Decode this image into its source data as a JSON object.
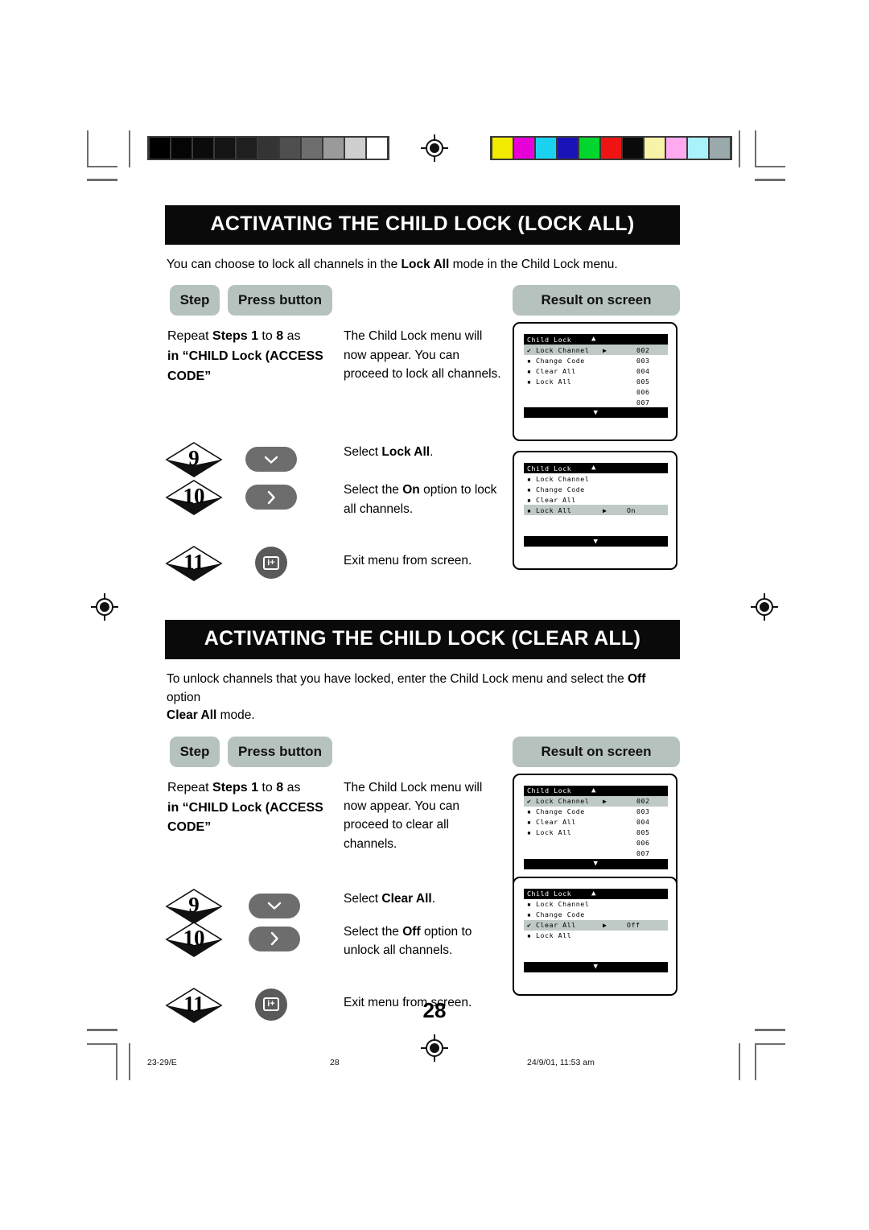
{
  "document": {
    "page_number": "28",
    "footer_left": "23-29/E",
    "footer_center": "28",
    "footer_right": "24/9/01, 11:53 am"
  },
  "print_marks": {
    "grayscale_steps": [
      "#000000",
      "#050505",
      "#0b0b0b",
      "#141414",
      "#1f1f1f",
      "#343434",
      "#4f4f4f",
      "#6e6e6e",
      "#9a9a9a",
      "#cfcfcf",
      "#ffffff"
    ],
    "color_bars": [
      "#f2ea00",
      "#e800d8",
      "#1ad2f0",
      "#1a13b8",
      "#00d62e",
      "#ef1414",
      "#0a0a0a",
      "#f7f3a8",
      "#ffaaf0",
      "#a9f2fb",
      "#9aa9ab"
    ]
  },
  "sections": [
    {
      "id": "lock-all",
      "heading_parts": [
        "A",
        "CTIVATING THE ",
        "C",
        "HILD ",
        "L",
        "OCK (",
        "L",
        "OCK ",
        "A",
        "LL)"
      ],
      "heading": "ACTIVATING THE CHILD LOCK (LOCK ALL)",
      "intro": {
        "before": "You can choose to lock all channels in the ",
        "bold": "Lock All",
        "after": " mode in the Child Lock menu."
      },
      "headers": {
        "step": "Step",
        "press": "Press button",
        "result": "Result on screen"
      },
      "rows": [
        {
          "step_label": "",
          "repeat_text": {
            "p1": "Repeat ",
            "b1": "Steps",
            "p2": " 1 ",
            "p3": "to ",
            "b2": "8",
            "p4": " as",
            "line2_pre": "in “",
            "line2_sc": "CHILD",
            "line2_b": " Lock (",
            "line2_sc2": "ACCESS",
            "line3_sc": "CODE",
            "line3_post": "”"
          },
          "description": "The Child Lock menu will now appear. You can proceed to lock all channels."
        },
        {
          "step_label": "9",
          "button": "down-arrow",
          "desc_pre": "Select ",
          "desc_b": "Lock All",
          "desc_post": "."
        },
        {
          "step_label": "10",
          "button": "right-arrow",
          "desc_pre": "Select the ",
          "desc_b": "On",
          "desc_post": " option to lock all channels."
        },
        {
          "step_label": "11",
          "button": "menu-exit",
          "desc_pre": "Exit menu from screen.",
          "desc_b": "",
          "desc_post": ""
        }
      ],
      "screens": [
        {
          "title": "Child Lock",
          "up_arrow": "▲",
          "down_arrow": "▼",
          "items": [
            {
              "mark": "check",
              "label": "Lock Channel",
              "arrow": "▶",
              "value": "",
              "highlight": true
            },
            {
              "mark": "square",
              "label": "Change Code",
              "arrow": "",
              "value": "",
              "highlight": false
            },
            {
              "mark": "square",
              "label": "Clear All",
              "arrow": "",
              "value": "",
              "highlight": false
            },
            {
              "mark": "square",
              "label": "Lock All",
              "arrow": "",
              "value": "",
              "highlight": false
            }
          ],
          "channel_numbers": [
            "002",
            "003",
            "004",
            "005",
            "006",
            "007"
          ]
        },
        {
          "title": "Child Lock",
          "up_arrow": "▲",
          "down_arrow": "▼",
          "items": [
            {
              "mark": "square",
              "label": "Lock Channel",
              "arrow": "",
              "value": "",
              "highlight": false
            },
            {
              "mark": "square",
              "label": "Change Code",
              "arrow": "",
              "value": "",
              "highlight": false
            },
            {
              "mark": "square",
              "label": "Clear All",
              "arrow": "",
              "value": "",
              "highlight": false
            },
            {
              "mark": "square",
              "label": "Lock All",
              "arrow": "▶",
              "value": "On",
              "highlight": true
            }
          ],
          "channel_numbers": []
        }
      ]
    },
    {
      "id": "clear-all",
      "heading": "ACTIVATING THE CHILD LOCK (CLEAR ALL)",
      "intro": {
        "before": "To unlock channels that you have locked, enter the Child Lock menu and select the ",
        "bold": "Off",
        "after": " option",
        "line2_b": "Clear All",
        "line2_after": " mode."
      },
      "headers": {
        "step": "Step",
        "press": "Press button",
        "result": "Result on screen"
      },
      "rows": [
        {
          "step_label": "",
          "description": "The Child Lock menu will now appear. You can proceed to clear all channels."
        },
        {
          "step_label": "9",
          "button": "down-arrow",
          "desc_pre": "Select ",
          "desc_b": "Clear All",
          "desc_post": "."
        },
        {
          "step_label": "10",
          "button": "right-arrow",
          "desc_pre": "Select the ",
          "desc_b": "Off",
          "desc_post": " option to unlock all channels."
        },
        {
          "step_label": "11",
          "button": "menu-exit",
          "desc_pre": "Exit menu from screen.",
          "desc_b": "",
          "desc_post": ""
        }
      ],
      "screens": [
        {
          "title": "Child Lock",
          "up_arrow": "▲",
          "down_arrow": "▼",
          "items": [
            {
              "mark": "check",
              "label": "Lock Channel",
              "arrow": "▶",
              "value": "",
              "highlight": true
            },
            {
              "mark": "square",
              "label": "Change Code",
              "arrow": "",
              "value": "",
              "highlight": false
            },
            {
              "mark": "square",
              "label": "Clear All",
              "arrow": "",
              "value": "",
              "highlight": false
            },
            {
              "mark": "square",
              "label": "Lock All",
              "arrow": "",
              "value": "",
              "highlight": false
            }
          ],
          "channel_numbers": [
            "002",
            "003",
            "004",
            "005",
            "006",
            "007"
          ]
        },
        {
          "title": "Child Lock",
          "up_arrow": "▲",
          "down_arrow": "▼",
          "items": [
            {
              "mark": "square",
              "label": "Lock Channel",
              "arrow": "",
              "value": "",
              "highlight": false
            },
            {
              "mark": "square",
              "label": "Change Code",
              "arrow": "",
              "value": "",
              "highlight": false
            },
            {
              "mark": "check",
              "label": "Clear All",
              "arrow": "▶",
              "value": "Off",
              "highlight": true
            },
            {
              "mark": "square",
              "label": "Lock All",
              "arrow": "",
              "value": "",
              "highlight": false
            }
          ],
          "channel_numbers": []
        }
      ]
    }
  ],
  "glyphs": {
    "check": "✔",
    "square": "▪",
    "down_chevron": "⌄",
    "right_chevron": "›",
    "menu_exit": "i+"
  }
}
